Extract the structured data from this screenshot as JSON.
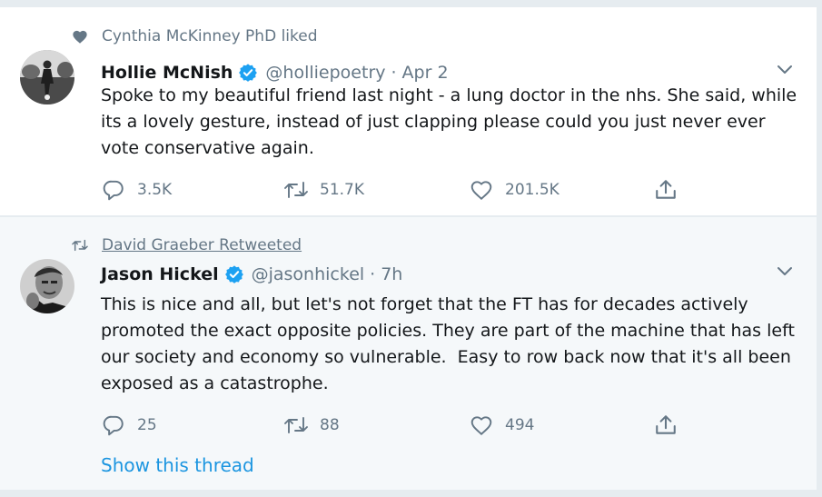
{
  "colors": {
    "accent": "#1da1f2",
    "link": "#1b95e0",
    "muted": "#657786",
    "text": "#14171a",
    "verified": "#1da1f2"
  },
  "tweets": [
    {
      "context_icon": "heart-icon",
      "context_text": "Cynthia McKinney PhD liked",
      "author_name": "Hollie McNish",
      "verified": true,
      "handle": "@holliepoetry",
      "separator": "·",
      "date": "Apr 2",
      "text": "Spoke to my beautiful friend last night - a lung doctor in the nhs. She said, while its a lovely gesture, instead of just clapping please could you just never ever vote conservative again.",
      "replies": "3.5K",
      "retweets": "51.7K",
      "likes": "201.5K"
    },
    {
      "context_icon": "retweet-icon",
      "context_text": "David Graeber Retweeted",
      "author_name": "Jason Hickel",
      "verified": true,
      "handle": "@jasonhickel",
      "separator": "·",
      "date": "7h",
      "text": "This is nice and all, but let's not forget that the FT has for decades actively promoted the exact opposite policies. They are part of the machine that has left our society and economy so vulnerable.  Easy to row back now that it's all been exposed as a catastrophe.",
      "replies": "25",
      "retweets": "88",
      "likes": "494",
      "show_thread": "Show this thread"
    }
  ]
}
